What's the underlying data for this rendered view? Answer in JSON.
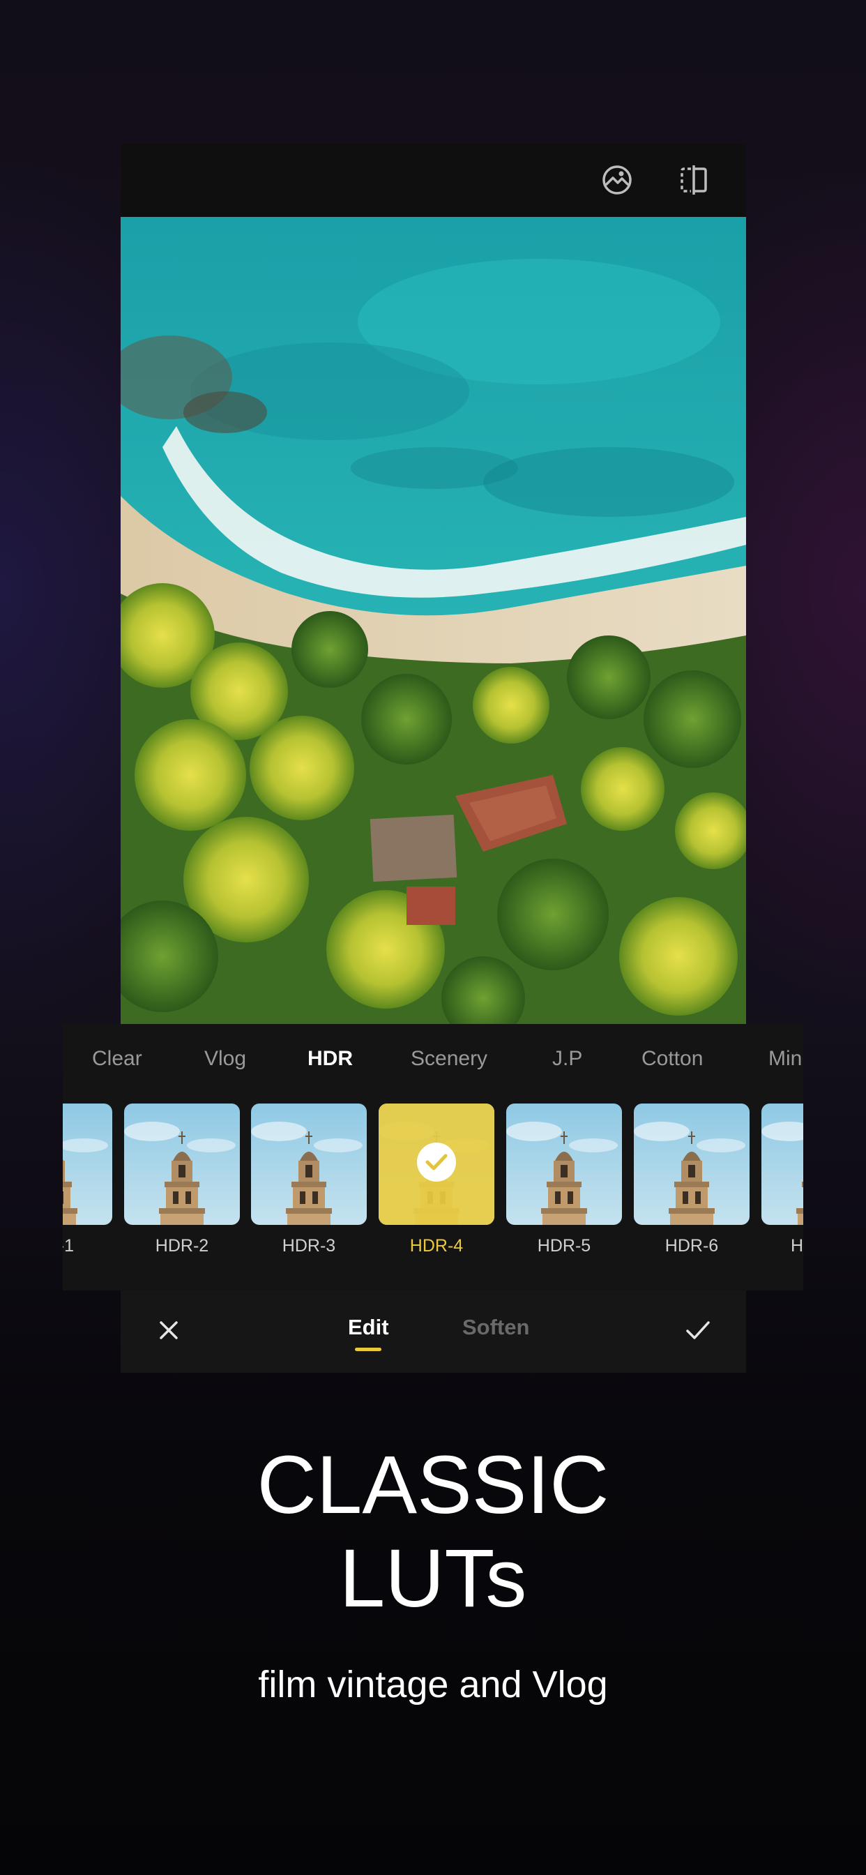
{
  "editor": {
    "top_icons": [
      "photo-adjust-icon",
      "compare-split-icon"
    ],
    "categories": [
      {
        "label": "Clear",
        "active": false
      },
      {
        "label": "Vlog",
        "active": false
      },
      {
        "label": "HDR",
        "active": true
      },
      {
        "label": "Scenery",
        "active": false
      },
      {
        "label": "J.P",
        "active": false
      },
      {
        "label": "Cotton",
        "active": false
      },
      {
        "label": "Min",
        "active": false
      }
    ],
    "presets": [
      {
        "label": "-1",
        "selected": false
      },
      {
        "label": "HDR-2",
        "selected": false
      },
      {
        "label": "HDR-3",
        "selected": false
      },
      {
        "label": "HDR-4",
        "selected": true
      },
      {
        "label": "HDR-5",
        "selected": false
      },
      {
        "label": "HDR-6",
        "selected": false
      },
      {
        "label": "H",
        "selected": false
      }
    ],
    "toolbar": {
      "cancel_icon": "close-icon",
      "confirm_icon": "check-icon",
      "tabs": [
        {
          "label": "Edit",
          "active": true
        },
        {
          "label": "Soften",
          "active": false
        }
      ]
    }
  },
  "promo": {
    "headline_line1": "CLASSIC",
    "headline_line2": "LUTs",
    "subline": "film vintage and Vlog"
  },
  "colors": {
    "accent": "#ecc93c",
    "panel_bg": "#141414",
    "toolbar_bg": "#161616",
    "topbar_bg": "#0f0f0f",
    "inactive_text": "#9a9a9a"
  }
}
